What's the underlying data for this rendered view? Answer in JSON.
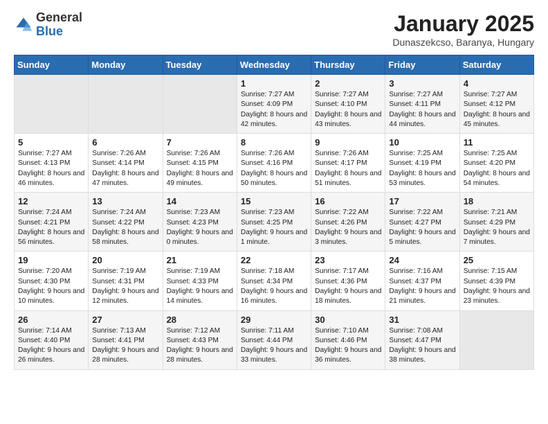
{
  "logo": {
    "general": "General",
    "blue": "Blue"
  },
  "title": "January 2025",
  "subtitle": "Dunaszekcso, Baranya, Hungary",
  "days_of_week": [
    "Sunday",
    "Monday",
    "Tuesday",
    "Wednesday",
    "Thursday",
    "Friday",
    "Saturday"
  ],
  "weeks": [
    [
      {
        "day": "",
        "text": ""
      },
      {
        "day": "",
        "text": ""
      },
      {
        "day": "",
        "text": ""
      },
      {
        "day": "1",
        "text": "Sunrise: 7:27 AM\nSunset: 4:09 PM\nDaylight: 8 hours and 42 minutes."
      },
      {
        "day": "2",
        "text": "Sunrise: 7:27 AM\nSunset: 4:10 PM\nDaylight: 8 hours and 43 minutes."
      },
      {
        "day": "3",
        "text": "Sunrise: 7:27 AM\nSunset: 4:11 PM\nDaylight: 8 hours and 44 minutes."
      },
      {
        "day": "4",
        "text": "Sunrise: 7:27 AM\nSunset: 4:12 PM\nDaylight: 8 hours and 45 minutes."
      }
    ],
    [
      {
        "day": "5",
        "text": "Sunrise: 7:27 AM\nSunset: 4:13 PM\nDaylight: 8 hours and 46 minutes."
      },
      {
        "day": "6",
        "text": "Sunrise: 7:26 AM\nSunset: 4:14 PM\nDaylight: 8 hours and 47 minutes."
      },
      {
        "day": "7",
        "text": "Sunrise: 7:26 AM\nSunset: 4:15 PM\nDaylight: 8 hours and 49 minutes."
      },
      {
        "day": "8",
        "text": "Sunrise: 7:26 AM\nSunset: 4:16 PM\nDaylight: 8 hours and 50 minutes."
      },
      {
        "day": "9",
        "text": "Sunrise: 7:26 AM\nSunset: 4:17 PM\nDaylight: 8 hours and 51 minutes."
      },
      {
        "day": "10",
        "text": "Sunrise: 7:25 AM\nSunset: 4:19 PM\nDaylight: 8 hours and 53 minutes."
      },
      {
        "day": "11",
        "text": "Sunrise: 7:25 AM\nSunset: 4:20 PM\nDaylight: 8 hours and 54 minutes."
      }
    ],
    [
      {
        "day": "12",
        "text": "Sunrise: 7:24 AM\nSunset: 4:21 PM\nDaylight: 8 hours and 56 minutes."
      },
      {
        "day": "13",
        "text": "Sunrise: 7:24 AM\nSunset: 4:22 PM\nDaylight: 8 hours and 58 minutes."
      },
      {
        "day": "14",
        "text": "Sunrise: 7:23 AM\nSunset: 4:23 PM\nDaylight: 9 hours and 0 minutes."
      },
      {
        "day": "15",
        "text": "Sunrise: 7:23 AM\nSunset: 4:25 PM\nDaylight: 9 hours and 1 minute."
      },
      {
        "day": "16",
        "text": "Sunrise: 7:22 AM\nSunset: 4:26 PM\nDaylight: 9 hours and 3 minutes."
      },
      {
        "day": "17",
        "text": "Sunrise: 7:22 AM\nSunset: 4:27 PM\nDaylight: 9 hours and 5 minutes."
      },
      {
        "day": "18",
        "text": "Sunrise: 7:21 AM\nSunset: 4:29 PM\nDaylight: 9 hours and 7 minutes."
      }
    ],
    [
      {
        "day": "19",
        "text": "Sunrise: 7:20 AM\nSunset: 4:30 PM\nDaylight: 9 hours and 10 minutes."
      },
      {
        "day": "20",
        "text": "Sunrise: 7:19 AM\nSunset: 4:31 PM\nDaylight: 9 hours and 12 minutes."
      },
      {
        "day": "21",
        "text": "Sunrise: 7:19 AM\nSunset: 4:33 PM\nDaylight: 9 hours and 14 minutes."
      },
      {
        "day": "22",
        "text": "Sunrise: 7:18 AM\nSunset: 4:34 PM\nDaylight: 9 hours and 16 minutes."
      },
      {
        "day": "23",
        "text": "Sunrise: 7:17 AM\nSunset: 4:36 PM\nDaylight: 9 hours and 18 minutes."
      },
      {
        "day": "24",
        "text": "Sunrise: 7:16 AM\nSunset: 4:37 PM\nDaylight: 9 hours and 21 minutes."
      },
      {
        "day": "25",
        "text": "Sunrise: 7:15 AM\nSunset: 4:39 PM\nDaylight: 9 hours and 23 minutes."
      }
    ],
    [
      {
        "day": "26",
        "text": "Sunrise: 7:14 AM\nSunset: 4:40 PM\nDaylight: 9 hours and 26 minutes."
      },
      {
        "day": "27",
        "text": "Sunrise: 7:13 AM\nSunset: 4:41 PM\nDaylight: 9 hours and 28 minutes."
      },
      {
        "day": "28",
        "text": "Sunrise: 7:12 AM\nSunset: 4:43 PM\nDaylight: 9 hours and 28 minutes."
      },
      {
        "day": "29",
        "text": "Sunrise: 7:11 AM\nSunset: 4:44 PM\nDaylight: 9 hours and 33 minutes."
      },
      {
        "day": "30",
        "text": "Sunrise: 7:10 AM\nSunset: 4:46 PM\nDaylight: 9 hours and 36 minutes."
      },
      {
        "day": "31",
        "text": "Sunrise: 7:08 AM\nSunset: 4:47 PM\nDaylight: 9 hours and 38 minutes."
      },
      {
        "day": "",
        "text": ""
      }
    ]
  ]
}
